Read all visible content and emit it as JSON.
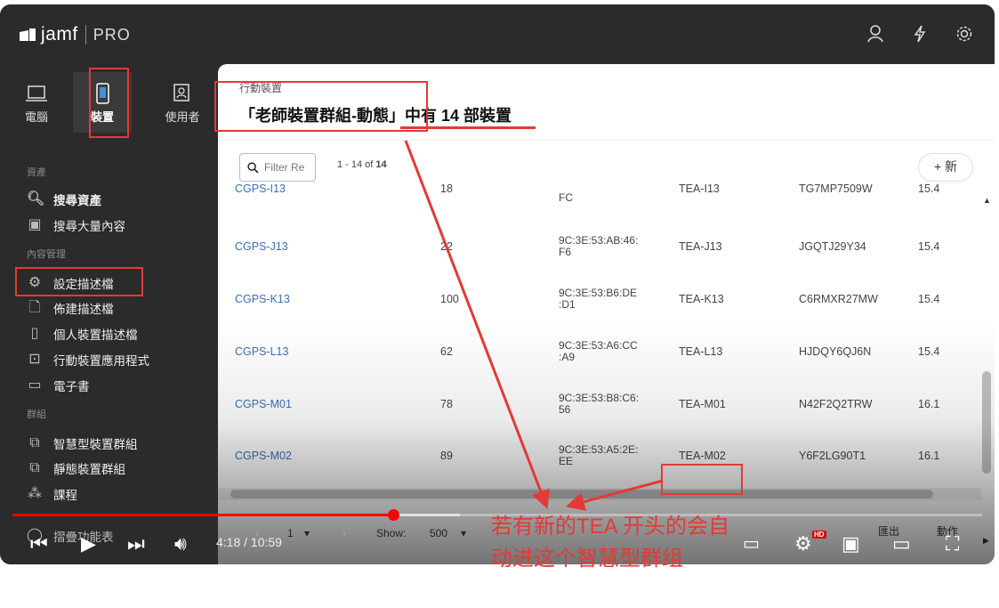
{
  "app": {
    "brand": "jamf",
    "edition": "PRO"
  },
  "nav_tabs": [
    {
      "label": "電腦",
      "icon": "laptop-icon"
    },
    {
      "label": "裝置",
      "icon": "phone-icon",
      "active": true
    },
    {
      "label": "使用者",
      "icon": "user-card-icon"
    }
  ],
  "sidebar": {
    "sections": [
      {
        "title": "資產"
      },
      {
        "title": "內容管理"
      },
      {
        "title": "群組"
      }
    ],
    "items": [
      {
        "label": "搜尋資產",
        "icon": "search-icon"
      },
      {
        "label": "搜尋大量內容",
        "icon": "bulk-search-icon"
      },
      {
        "label": "設定描述檔",
        "icon": "gear-icon"
      },
      {
        "label": "佈建描述檔",
        "icon": "provision-icon"
      },
      {
        "label": "個人裝置描述檔",
        "icon": "personal-device-icon"
      },
      {
        "label": "行動裝置應用程式",
        "icon": "app-icon"
      },
      {
        "label": "電子書",
        "icon": "book-icon"
      },
      {
        "label": "智慧型裝置群組",
        "icon": "smart-group-icon"
      },
      {
        "label": "靜態裝置群組",
        "icon": "static-group-icon"
      },
      {
        "label": "課程",
        "icon": "classes-icon"
      },
      {
        "label": "摺疊功能表",
        "icon": "collapse-icon"
      }
    ]
  },
  "main": {
    "breadcrumb": "行動裝置",
    "title": "「老師裝置群組-動態」中有 14 部裝置",
    "filter_placeholder": "Filter Re",
    "count_range": "1 - 14 of ",
    "count_total": "14",
    "new_button": "+  新",
    "rows": [
      {
        "name": "CGPS-I13",
        "col2": "18",
        "mac": "FC",
        "user": "TEA-I13",
        "serial": "TG7MP7509W",
        "os": "15.4"
      },
      {
        "name": "CGPS-J13",
        "col2": "22",
        "mac": "9C:3E:53:AB:46:\nF6",
        "user": "TEA-J13",
        "serial": "JGQTJ29Y34",
        "os": "15.4"
      },
      {
        "name": "CGPS-K13",
        "col2": "100",
        "mac": "9C:3E:53:B6:DE\n:D1",
        "user": "TEA-K13",
        "serial": "C6RMXR27MW",
        "os": "15.4"
      },
      {
        "name": "CGPS-L13",
        "col2": "62",
        "mac": "9C:3E:53:A6:CC\n:A9",
        "user": "TEA-L13",
        "serial": "HJDQY6QJ6N",
        "os": "15.4"
      },
      {
        "name": "CGPS-M01",
        "col2": "78",
        "mac": "9C:3E:53:B8:C6:\n56",
        "user": "TEA-M01",
        "serial": "N42F2Q2TRW",
        "os": "16.1"
      },
      {
        "name": "CGPS-M02",
        "col2": "89",
        "mac": "9C:3E:53:A5:2E:\nEE",
        "user": "TEA-M02",
        "serial": "Y6F2LG90T1",
        "os": "16.1"
      }
    ],
    "pager": {
      "page": "1",
      "show_label": "Show:",
      "show_value": "500",
      "export_label": "匯出",
      "action_label": "動作"
    }
  },
  "player": {
    "time": "4:18 / 10:59",
    "progress": 0.394,
    "buffered": 0.462,
    "hd_badge": "HD"
  },
  "annotation": {
    "text": "若有新的TEA 开头的会自动进这个智慧型群组",
    "color": "#e53935"
  },
  "colors": {
    "sidebar_bg": "#2b2b2b",
    "link": "#3b6fb6",
    "accent": "#e53935"
  }
}
